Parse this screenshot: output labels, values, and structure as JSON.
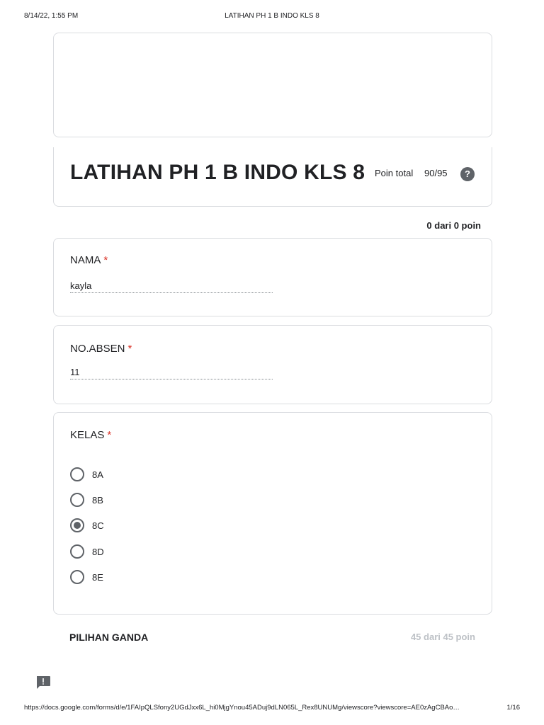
{
  "print_header": {
    "datetime": "8/14/22, 1:55 PM",
    "title": "LATIHAN PH 1 B INDO KLS 8"
  },
  "form": {
    "title": "LATIHAN PH 1 B INDO KLS 8",
    "points_label": "Poin total",
    "points_value": "90/95",
    "help_glyph": "?"
  },
  "section_score": "0 dari 0 poin",
  "questions": {
    "nama": {
      "label": "NAMA",
      "required_mark": "*",
      "answer": "kayla"
    },
    "absen": {
      "label": "NO.ABSEN",
      "required_mark": "*",
      "answer": "11"
    },
    "kelas": {
      "label": "KELAS",
      "required_mark": "*",
      "options": [
        "8A",
        "8B",
        "8C",
        "8D",
        "8E"
      ],
      "selected": "8C"
    }
  },
  "section": {
    "title": "PILIHAN GANDA",
    "points": "45 dari 45 poin"
  },
  "icons": {
    "help": "help-circle-icon",
    "feedback": "feedback-icon"
  },
  "colors": {
    "required": "#d93025",
    "border": "#dadce0",
    "radio": "#5f6368",
    "muted_points": "#bdc1c6"
  },
  "print_footer": {
    "url": "https://docs.google.com/forms/d/e/1FAIpQLSfony2UGdJxx6L_hi0MjgYnou45ADuj9dLN065L_Rex8UNUMg/viewscore?viewscore=AE0zAgCBAo…",
    "page": "1/16"
  }
}
